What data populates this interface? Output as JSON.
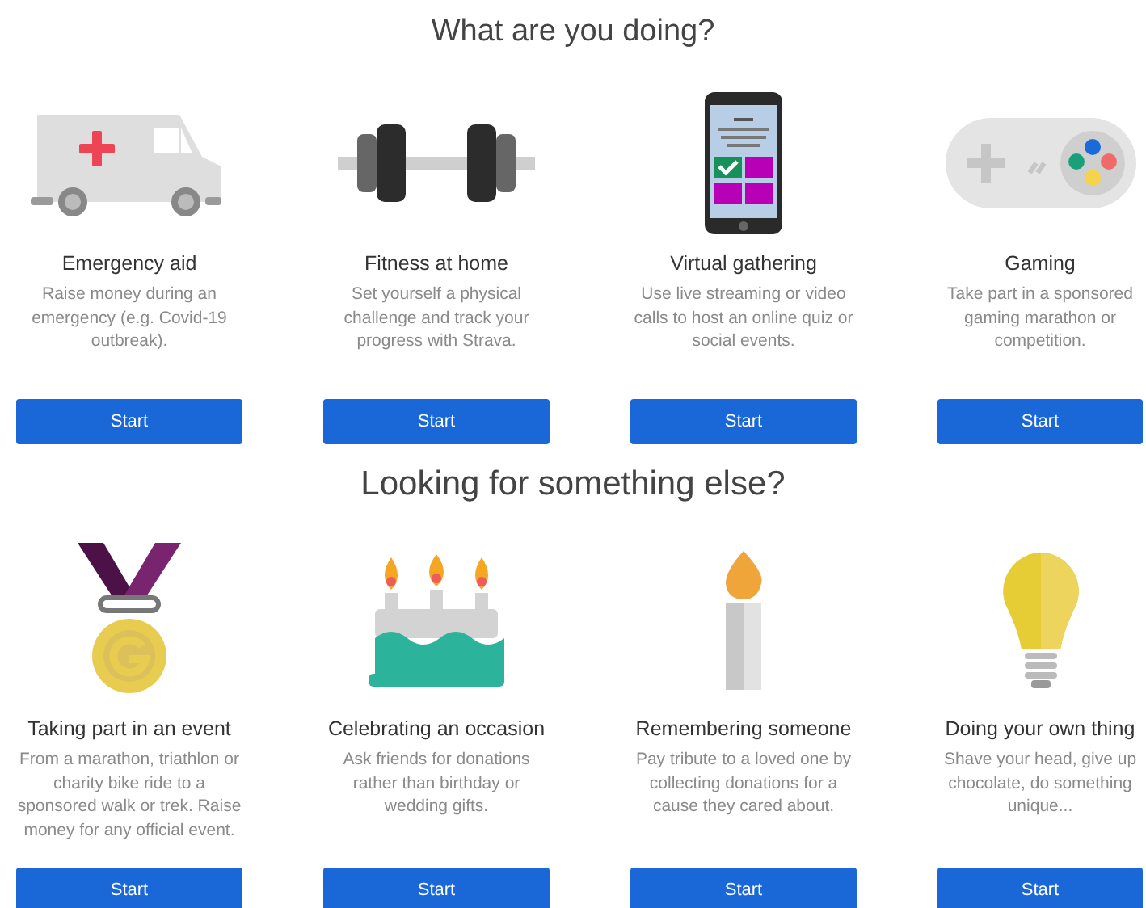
{
  "sections": [
    {
      "heading": "What are you doing?",
      "cards": [
        {
          "kind": "ambulance",
          "title": "Emergency aid",
          "description": "Raise money during an emergency (e.g. Covid-19 outbreak).",
          "button": "Start"
        },
        {
          "kind": "dumbbell",
          "title": "Fitness at home",
          "description": "Set yourself a physical challenge and track your progress with Strava.",
          "button": "Start"
        },
        {
          "kind": "phone",
          "title": "Virtual gathering",
          "description": "Use live streaming or video calls to host an online quiz or social events.",
          "button": "Start"
        },
        {
          "kind": "gamepad",
          "title": "Gaming",
          "description": "Take part in a sponsored gaming marathon or competition.",
          "button": "Start"
        }
      ]
    },
    {
      "heading": "Looking for something else?",
      "cards": [
        {
          "kind": "medal",
          "title": "Taking part in an event",
          "description": "From a marathon, triathlon or charity bike ride to a sponsored walk or trek. Raise money for any official event.",
          "button": "Start"
        },
        {
          "kind": "cake",
          "title": "Celebrating an occasion",
          "description": "Ask friends for donations rather than birthday or wedding gifts.",
          "button": "Start"
        },
        {
          "kind": "candle",
          "title": "Remembering someone",
          "description": "Pay tribute to a loved one by collecting donations for a cause they cared about.",
          "button": "Start"
        },
        {
          "kind": "bulb",
          "title": "Doing your own thing",
          "description": "Shave your head, give up chocolate, do something unique...",
          "button": "Start"
        }
      ]
    }
  ]
}
